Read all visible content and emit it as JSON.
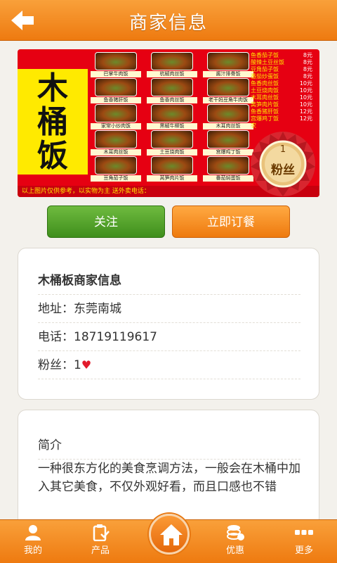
{
  "header": {
    "title": "商家信息",
    "back_icon": "arrow-left-icon"
  },
  "banner": {
    "title_chars": [
      "木",
      "桶",
      "饭"
    ],
    "dishes": [
      "巴掌牛肉饭",
      "杭椒肉丝饭",
      "酱汁排骨饭",
      "鱼香猪肝饭",
      "鱼香肉丝饭",
      "老干妈豆角牛肉饭",
      "家常小炒肉饭",
      "黑椒牛柳饭",
      "木耳肉丝饭",
      "木耳肉丝饭",
      "土豆烧肉饭",
      "宫爆鸡丁饭",
      "豆角茄子饭",
      "莴笋肉片饭",
      "番茄焖蛋饭"
    ],
    "prices": [
      {
        "name": "鱼香茄子饭",
        "price": "8元"
      },
      {
        "name": "酸辣土豆丝饭",
        "price": "8元"
      },
      {
        "name": "豆角茄子饭",
        "price": "8元"
      },
      {
        "name": "番茄炒蛋饭",
        "price": "8元"
      },
      {
        "name": "鱼香肉丝饭",
        "price": "10元"
      },
      {
        "name": "土豆烧肉饭",
        "price": "10元"
      },
      {
        "name": "木耳肉丝饭",
        "price": "10元"
      },
      {
        "name": "莴笋肉片饭",
        "price": "10元"
      },
      {
        "name": "鱼香猪肝饭",
        "price": "12元"
      },
      {
        "name": "宫爆鸡丁饭",
        "price": "12元"
      },
      {
        "name": "农",
        "price": ""
      }
    ],
    "footer": "以上图片仅供参考，以实物为主  送外卖电话："
  },
  "fans_badge": {
    "count": "1",
    "label": "粉丝"
  },
  "actions": {
    "follow_label": "关注",
    "order_label": "立即订餐"
  },
  "merchant": {
    "title": "木桶板商家信息",
    "address_label": "地址：",
    "address": "东莞南城",
    "phone_label": "电话：",
    "phone": "18719119617",
    "fans_label": "粉丝：",
    "fans": "1",
    "fans_icon": "heart-icon"
  },
  "intro": {
    "title": "简介",
    "text": "一种很东方化的美食烹调方法，一般会在木桶中加入其它美食，不仅外观好看，而且口感也不错"
  },
  "bottom_nav": {
    "items": [
      {
        "label": "我的",
        "icon": "user-icon"
      },
      {
        "label": "产品",
        "icon": "clipboard-icon"
      },
      {
        "label": "优惠",
        "icon": "coins-icon"
      },
      {
        "label": "更多",
        "icon": "more-icon"
      }
    ],
    "home_icon": "home-icon"
  },
  "colors": {
    "accent": "#f08412",
    "follow_green": "#4f9e28",
    "banner_red": "#e60012"
  }
}
